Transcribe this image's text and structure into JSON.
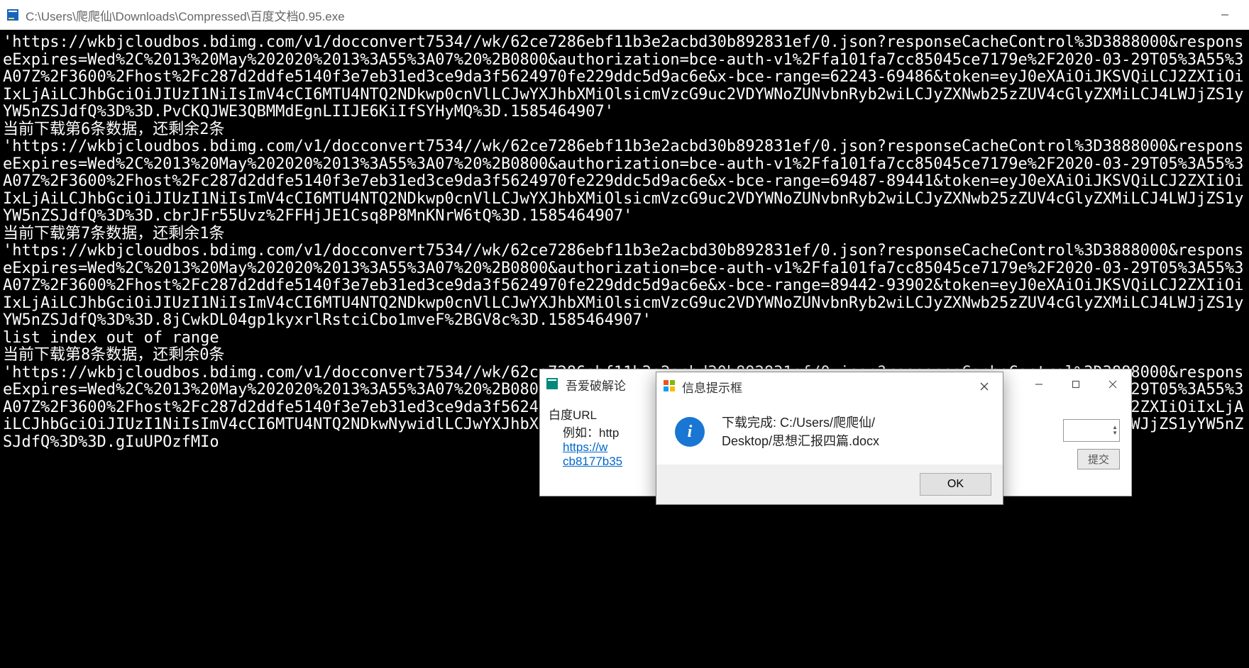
{
  "main_window": {
    "path": "C:\\Users\\爬爬仙\\Downloads\\Compressed\\百度文档0.95.exe"
  },
  "console": {
    "text": "'https://wkbjcloudbos.bdimg.com/v1/docconvert7534//wk/62ce7286ebf11b3e2acbd30b892831ef/0.json?responseCacheControl%3D3888000&responseExpires=Wed%2C%2013%20May%202020%2013%3A55%3A07%20%2B0800&authorization=bce-auth-v1%2Ffa101fa7cc85045ce7179e%2F2020-03-29T05%3A55%3A07Z%2F3600%2Fhost%2Fc287d2ddfe5140f3e7eb31ed3ce9da3f5624970fe229ddc5d9ac6e&x-bce-range=62243-69486&token=eyJ0eXAiOiJKSVQiLCJ2ZXIiOiIxLjAiLCJhbGciOiJIUzI1NiIsImV4cCI6MTU4NTQ2NDkwp0cnVlLCJwYXJhbXMiOlsicmVzcG9uc2VDYWNoZUNvbnRyb2wiLCJyZXNwb25zZUV4cGlyZXMiLCJ4LWJjZS1yYW5nZSJdfQ%3D%3D.PvCKQJWE3QBMMdEgnLIIJE6KiIfSYHyMQ%3D.1585464907'\n当前下载第6条数据，还剩余2条\n'https://wkbjcloudbos.bdimg.com/v1/docconvert7534//wk/62ce7286ebf11b3e2acbd30b892831ef/0.json?responseCacheControl%3D3888000&responseExpires=Wed%2C%2013%20May%202020%2013%3A55%3A07%20%2B0800&authorization=bce-auth-v1%2Ffa101fa7cc85045ce7179e%2F2020-03-29T05%3A55%3A07Z%2F3600%2Fhost%2Fc287d2ddfe5140f3e7eb31ed3ce9da3f5624970fe229ddc5d9ac6e&x-bce-range=69487-89441&token=eyJ0eXAiOiJKSVQiLCJ2ZXIiOiIxLjAiLCJhbGciOiJIUzI1NiIsImV4cCI6MTU4NTQ2NDkwp0cnVlLCJwYXJhbXMiOlsicmVzcG9uc2VDYWNoZUNvbnRyb2wiLCJyZXNwb25zZUV4cGlyZXMiLCJ4LWJjZS1yYW5nZSJdfQ%3D%3D.cbrJFr55Uvz%2FFHjJE1Csq8P8MnKNrW6tQ%3D.1585464907'\n当前下载第7条数据，还剩余1条\n'https://wkbjcloudbos.bdimg.com/v1/docconvert7534//wk/62ce7286ebf11b3e2acbd30b892831ef/0.json?responseCacheControl%3D3888000&responseExpires=Wed%2C%2013%20May%202020%2013%3A55%3A07%20%2B0800&authorization=bce-auth-v1%2Ffa101fa7cc85045ce7179e%2F2020-03-29T05%3A55%3A07Z%2F3600%2Fhost%2Fc287d2ddfe5140f3e7eb31ed3ce9da3f5624970fe229ddc5d9ac6e&x-bce-range=89442-93902&token=eyJ0eXAiOiJKSVQiLCJ2ZXIiOiIxLjAiLCJhbGciOiJIUzI1NiIsImV4cCI6MTU4NTQ2NDkwp0cnVlLCJwYXJhbXMiOlsicmVzcG9uc2VDYWNoZUNvbnRyb2wiLCJyZXNwb25zZUV4cGlyZXMiLCJ4LWJjZS1yYW5nZSJdfQ%3D%3D.8jCwkDL04gp1kyxrlRstciCbo1mveF%2BGV8c%3D.1585464907'\nlist index out of range\n当前下载第8条数据，还剩余0条\n'https://wkbjcloudbos.bdimg.com/v1/docconvert7534//wk/62ce7286ebf11b3e2acbd30b892831ef/0.json?responseCacheControl%3D3888000&responseExpires=Wed%2C%2013%20May%202020%2013%3A55%3A07%20%2B0800&authorization=bce-auth-v1%2Ffa101fa7cc85045ce7179e%2F2020-03-29T05%3A55%3A07Z%2F3600%2Fhost%2Fc287d2ddfe5140f3e7eb31ed3ce9da3f5624970fe229ddc5d9ac6e&x-bce-range=93903-&token=eyJ0eXAiOiJKSVQiLCJ2ZXIiOiIxLjAiLCJhbGciOiJIUzI1NiIsImV4cCI6MTU4NTQ2NDkwNywidlLCJwYXJhbXMiOlsicmVzcG9uc2VDYWNoZUNvbnRyb2wiLCJyZXNwb25zZUV4cGlyZXMiLCJ4LWJjZS1yYW5nZSJdfQ%3D%3D.gIuUPOzfMIo"
  },
  "back_dialog": {
    "title": "吾爱破解论",
    "label_url": "白度URL",
    "example_prefix": "例如：http",
    "link_line1": "https://w",
    "link_line2": "cb8177b35",
    "submit": "提交"
  },
  "msgbox": {
    "title": "信息提示框",
    "icon_label": "info",
    "message_line1": "下载完成: C:/Users/爬爬仙/",
    "message_line2": "Desktop/思想汇报四篇.docx",
    "ok": "OK"
  }
}
